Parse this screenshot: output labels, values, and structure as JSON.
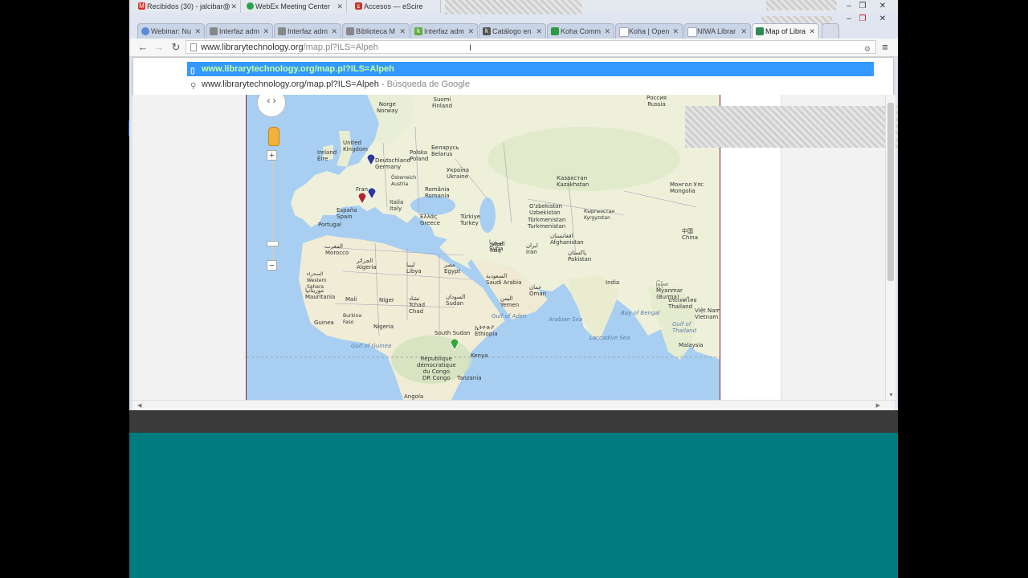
{
  "window_tabs": [
    {
      "title": "Recibidos (30) - jalcibar@",
      "icon": "gmail-icon",
      "color": "#d93025"
    },
    {
      "title": "WebEx Meeting Center",
      "icon": "webex-icon",
      "color": "#2aa24a"
    },
    {
      "title": "Accesos — eScire",
      "icon": "escire-icon",
      "color": "#c0392b"
    }
  ],
  "tabs": [
    {
      "title": "Webinar: Nu",
      "color": "#5b8bd8"
    },
    {
      "title": "Interfaz adm",
      "color": "#888888"
    },
    {
      "title": "Interfaz adm",
      "color": "#888888"
    },
    {
      "title": "Biblioteca M",
      "color": "#888888"
    },
    {
      "title": "Interfaz adm",
      "color": "#5fae3c"
    },
    {
      "title": "Catálogo en",
      "color": "#555555"
    },
    {
      "title": "Koha Comm",
      "color": "#2e9a44"
    },
    {
      "title": "Koha | Open",
      "color": "#aaaaaa"
    },
    {
      "title": "NIWA Librar",
      "color": "#aaaaaa"
    },
    {
      "title": "Map of Libra",
      "color": "#2e8b57",
      "active": true
    }
  ],
  "omnibox": {
    "host": "www.librarytechnology.org",
    "path": "/map.pl?ILS=Alpeh"
  },
  "suggestions": {
    "selected": "www.librarytechnology.org/map.pl?ILS=Alpeh",
    "search_query": "www.librarytechnology.org/map.pl?ILS=Alpeh",
    "search_hint": " - Búsqueda de Google"
  },
  "map_labels": {
    "finland": "Suomi\nFinland",
    "norway": "Norge\nNorway",
    "russia": "Россия\nRussia",
    "uk": "United\nKingdom",
    "ireland": "Ireland\nÉire",
    "poland": "Polska\nPoland",
    "belarus": "Беларусь\nBelarus",
    "germany": "Deutschland\nGermany",
    "austria": "Österreich\nAustria",
    "ukraine": "Україна\nUkraine",
    "kazakhstan": "Казахстан\nKazakhstan",
    "mongolia": "Монгол Улс\nMongolia",
    "france": "Fran",
    "romania": "România\nRomania",
    "italy": "Italia\nItaly",
    "spain": "España\nSpain",
    "portugal": "Portugal",
    "greece": "Ελλάς\nGreece",
    "turkey": "Türkiye\nTurkey",
    "uzbekistan": "O'zbekiston\nUzbekistan",
    "kyrgyzstan": "Кыргызстан\nKyrgyzstan",
    "turkmenistan": "Türkmenistan\nTurkmenistan",
    "syria": "سوريا\nSyria",
    "iraq": "العراق\nIraq",
    "iran": "ایران\nIran",
    "afghanistan": "افغانستان\nAfghanistan",
    "pakistan": "پاکستان\nPakistan",
    "china": "中国\nChina",
    "morocco": "المغرب\nMorocco",
    "algeria": "الجزائر\nAlgeria",
    "libya": "ليبيا\nLibya",
    "egypt": "مصر\nEgypt",
    "saudi": "السعودية\nSaudi Arabia",
    "oman": "عمان\nOman",
    "india": "India",
    "myanmar": "မြန်မာ\nMyanmar\n(Burma)",
    "thailand": "ประเทศไทย\nThailand",
    "vietnam": "Việt Nam\nVietnam",
    "wsahara": "الصحراء\nWestern\nSahara",
    "mauritania": "موريتانيا\nMauritania",
    "mali": "Mali",
    "niger": "Niger",
    "chad": "تشاد\nTchad\nChad",
    "sudan": "السودان\nSudan",
    "yemen": "اليمن\nYemen",
    "guinea": "Guinea",
    "burkina": "Burkina\nFaso",
    "nigeria": "Nigeria",
    "southsudan": "South Sudan",
    "ethiopia": "ኢትዮጵያ\nEthiopia",
    "kenya": "Kenya",
    "drc": "République\ndémocratique\ndu Congo\nDR Congo",
    "tanzania": "Tanzania",
    "angola": "Angola",
    "malaysia": "Malaysia",
    "arabian_sea": "Arabian Sea",
    "bay_bengal": "Bay of Bengal",
    "gulf_aden": "Gulf of Aden",
    "gulf_guinea": "Gulf of Guinea",
    "laccadive": "Laccadive Sea",
    "gulf_thailand": "Gulf of\nThailand"
  },
  "map_controls": {
    "zoom_in": "+",
    "zoom_out": "−"
  },
  "colors": {
    "selected_bg": "#3399ff",
    "teal": "#007b7f",
    "map_water": "#a8cff2",
    "map_land": "#f0ecd8"
  }
}
